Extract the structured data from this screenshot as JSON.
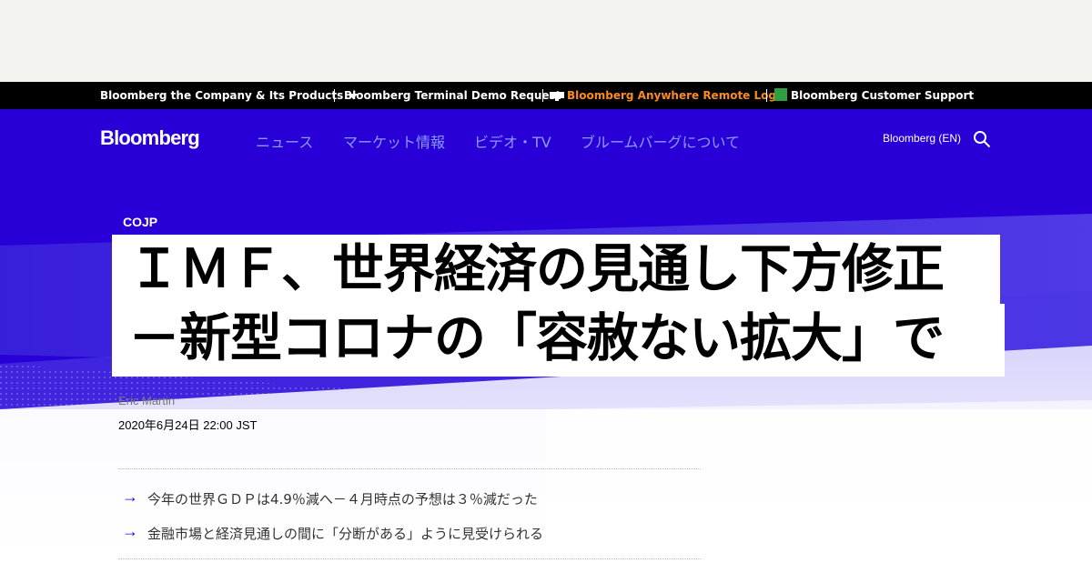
{
  "corp_bar": {
    "company_label": "Bloomberg the Company & Its Products",
    "terminal_demo_label": "Bloomberg Terminal Demo Request",
    "anywhere_login_label": "Bloomberg Anywhere Remote Login",
    "support_label": "Bloomberg Customer Support"
  },
  "nav": {
    "logo": "Bloomberg",
    "items": [
      {
        "label": "ニュース"
      },
      {
        "label": "マーケット情報"
      },
      {
        "label": "ビデオ・TV"
      },
      {
        "label": "ブルームバーグについて"
      }
    ],
    "edition_label": "Bloomberg (EN)"
  },
  "article": {
    "kicker": "COJP",
    "headline_lines": [
      "ＩＭＦ、世界経済の見通し下方修正",
      "－新型コロナの「容赦ない拡大」で"
    ],
    "author": "Eric Martin",
    "date": "2020年6月24日 22:00 JST",
    "summary": [
      "今年の世界ＧＤＰは4.9％減へ－４月時点の予想は３％減だった",
      "金融市場と経済見通しの間に「分断がある」ように見受けられる"
    ]
  },
  "colors": {
    "brand_blue": "#2800d7",
    "nav_link": "#8c99ff",
    "orange_link": "#fb8b1e"
  }
}
